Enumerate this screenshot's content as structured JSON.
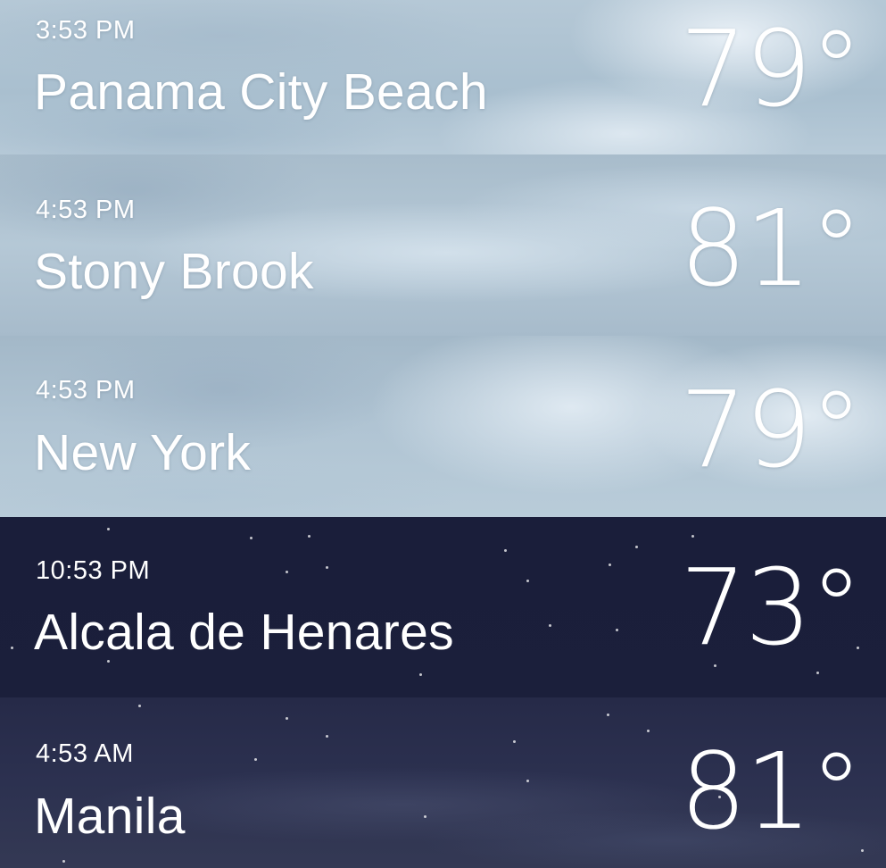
{
  "locations": [
    {
      "time": "3:53 PM",
      "city": "Panama City Beach",
      "temperature": "79°",
      "condition": "cloudy"
    },
    {
      "time": "4:53 PM",
      "city": "Stony Brook",
      "temperature": "81°",
      "condition": "cloudy"
    },
    {
      "time": "4:53 PM",
      "city": "New York",
      "temperature": "79°",
      "condition": "cloudy"
    },
    {
      "time": "10:53 PM",
      "city": "Alcala de Henares",
      "temperature": "73°",
      "condition": "clear-night"
    },
    {
      "time": "4:53 AM",
      "city": "Manila",
      "temperature": "81°",
      "condition": "cloudy-night"
    }
  ],
  "colors": {
    "text": "#ffffff",
    "day_cloud_sky": "#b0c4d3",
    "night_sky": "#1b1f3b",
    "night_cloudy_sky": "#2c3150"
  }
}
